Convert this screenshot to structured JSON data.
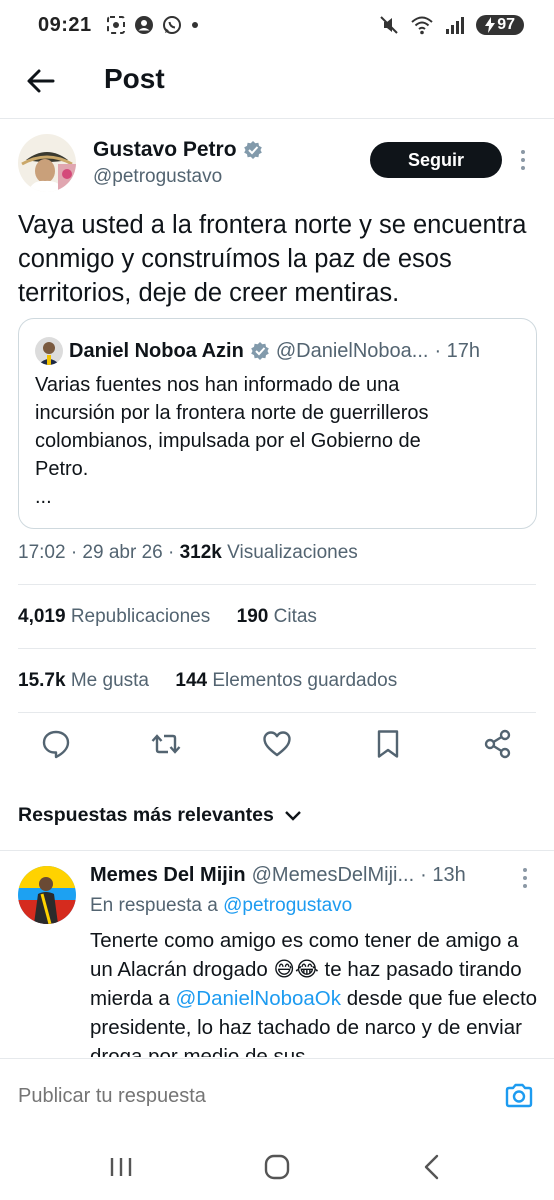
{
  "status_bar": {
    "time": "09:21",
    "battery": "97"
  },
  "header": {
    "title": "Post"
  },
  "tweet": {
    "author_name": "Gustavo Petro",
    "author_handle": "@petrogustavo",
    "follow_label": "Seguir",
    "text": "Vaya usted a la frontera norte y se encuentra conmigo y construímos la paz de esos territorios, deje de creer mentiras.",
    "quote": {
      "name": "Daniel Noboa Azin",
      "handle": "@DanielNoboa...",
      "time": "· 17h",
      "text_lines": [
        "Varias fuentes nos han informado de una",
        "incursión por la frontera norte de guerrilleros",
        "colombianos, impulsada por el Gobierno de",
        "Petro.",
        "..."
      ]
    },
    "meta": {
      "time": "17:02",
      "date": "· 29 abr 26 ·",
      "views_count": "312k",
      "views_label": "Visualizaciones"
    },
    "stats": {
      "reposts_count": "4,019",
      "reposts_label": "Republicaciones",
      "quotes_count": "190",
      "quotes_label": "Citas",
      "likes_count": "15.7k",
      "likes_label": "Me gusta",
      "bookmarks_count": "144",
      "bookmarks_label": "Elementos guardados"
    }
  },
  "replies_section": {
    "title": "Respuestas más relevantes"
  },
  "reply": {
    "name": "Memes Del Mijin",
    "handle": "@MemesDelMiji...",
    "time": "· 13h",
    "in_reply_prefix": "En respuesta a",
    "in_reply_handle": "@petrogustavo",
    "text_part1": "Tenerte como amigo es como tener de amigo a un Alacrán drogado ",
    "emoji": "😅😂",
    "text_part2": " te haz pasado tirando mierda a ",
    "mention": "@DanielNoboaOk",
    "text_part3": " desde que fue electo presidente, lo haz tachado de narco y de enviar droga por medio de sus"
  },
  "composer": {
    "placeholder": "Publicar tu respuesta"
  },
  "colors": {
    "accent": "#1d9bf0",
    "text": "#0f1419",
    "muted": "#536471",
    "verified": "#829aab"
  },
  "icons": {
    "back": "arrow-left-icon",
    "verified": "verified-badge-icon",
    "reply": "comment-icon",
    "repost": "repost-icon",
    "like": "heart-icon",
    "bookmark": "bookmark-icon",
    "share": "share-icon",
    "camera": "camera-icon"
  }
}
